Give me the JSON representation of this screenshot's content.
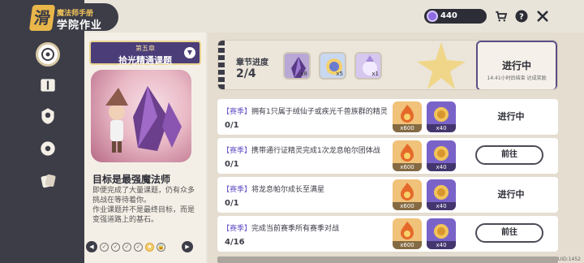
{
  "header": {
    "logo_sub": "魔法师手册",
    "logo_title": "学院作业",
    "logo_badge": "滑"
  },
  "topbar": {
    "coins": "440"
  },
  "chapter": {
    "chapter_num": "第五章",
    "chapter_name": "拾光精通课题",
    "goal_title": "目标是最强魔法师",
    "goal_desc_1": "即便完成了大量课题，仍有众多挑战在等待着你。",
    "goal_desc_2": "作业课题并不是最终目标，而是变强道路上的基石。"
  },
  "progress": {
    "label": "章节进度",
    "value": "2/4",
    "rewards": [
      {
        "icon": "crystal-icon",
        "count": "x8"
      },
      {
        "icon": "moon-orb-icon",
        "count": "x5"
      },
      {
        "icon": "spirit-icon",
        "count": "x1"
      }
    ],
    "status": "进行中",
    "status_sub": "14:41小时后结束 达成奖励"
  },
  "tasks": [
    {
      "tag": "【赛季】",
      "desc": "拥有1只属于绒仙子或疾光千兽族群的精灵",
      "progress": "0/1",
      "reward1": "x600",
      "reward2": "x40",
      "action": "进行中",
      "action_type": "status"
    },
    {
      "tag": "【赛季】",
      "desc": "携带通行证精灵完成1次龙息帕尔团体战",
      "progress": "0/1",
      "reward1": "x600",
      "reward2": "x40",
      "action": "前往",
      "action_type": "button"
    },
    {
      "tag": "【赛季】",
      "desc": "将龙息帕尔成长至满星",
      "progress": "0/1",
      "reward1": "x600",
      "reward2": "x40",
      "action": "进行中",
      "action_type": "status"
    },
    {
      "tag": "【赛季】",
      "desc": "完成当前赛季所有赛季对战",
      "progress": "4/16",
      "reward1": "x600",
      "reward2": "x40",
      "action": "前往",
      "action_type": "button"
    }
  ],
  "footer": {
    "id": "UID:1452"
  }
}
